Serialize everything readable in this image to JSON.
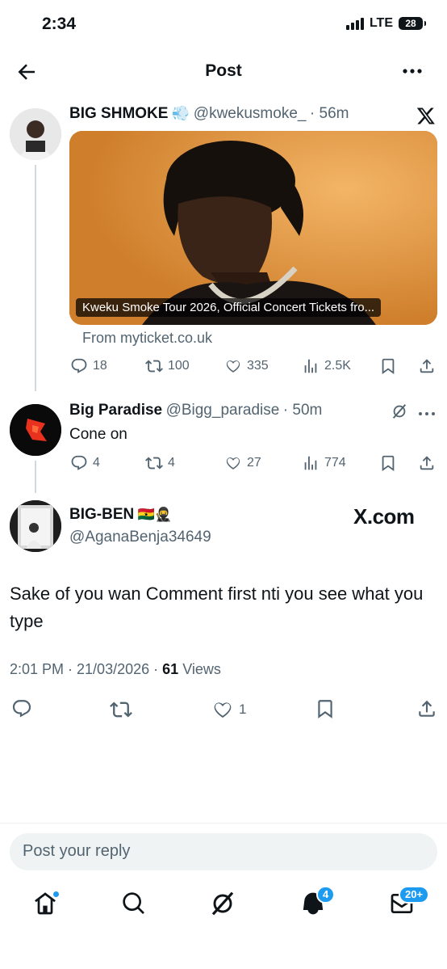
{
  "status": {
    "time": "2:34",
    "network": "LTE",
    "battery": "28"
  },
  "header": {
    "title": "Post",
    "back_icon": "arrow-left-icon",
    "more_icon": "more-horizontal-icon"
  },
  "tweet1": {
    "name": "BIG SHMOKE",
    "emoji": "💨",
    "handle": "@kwekusmoke_",
    "time": "· 56m",
    "media_caption": "Kweku Smoke Tour 2026, Official Concert Tickets fro...",
    "from": "From myticket.co.uk",
    "replies": "18",
    "reposts": "100",
    "likes": "335",
    "views": "2.5K"
  },
  "tweet2": {
    "name": "Big Paradise",
    "handle": "@Bigg_paradise",
    "time": "· 50m",
    "text": "Cone on",
    "replies": "4",
    "reposts": "4",
    "likes": "27",
    "views": "774"
  },
  "main_post": {
    "name": "BIG-BEN",
    "emoji": "🇬🇭🥷",
    "handle": "@AganaBenja34649",
    "watermark": "X.com",
    "text": "Sake of you wan Comment first nti you see what you type",
    "time": "2:01 PM · 21/03/2026 ·",
    "views_count": "61",
    "views_label": "Views",
    "likes": "1"
  },
  "reply": {
    "placeholder": "Post your reply"
  },
  "tabs": {
    "notifications_badge": "4",
    "messages_badge": "20+"
  },
  "colors": {
    "accent": "#1d9bf0",
    "text": "#0f1419",
    "muted": "#536471"
  }
}
